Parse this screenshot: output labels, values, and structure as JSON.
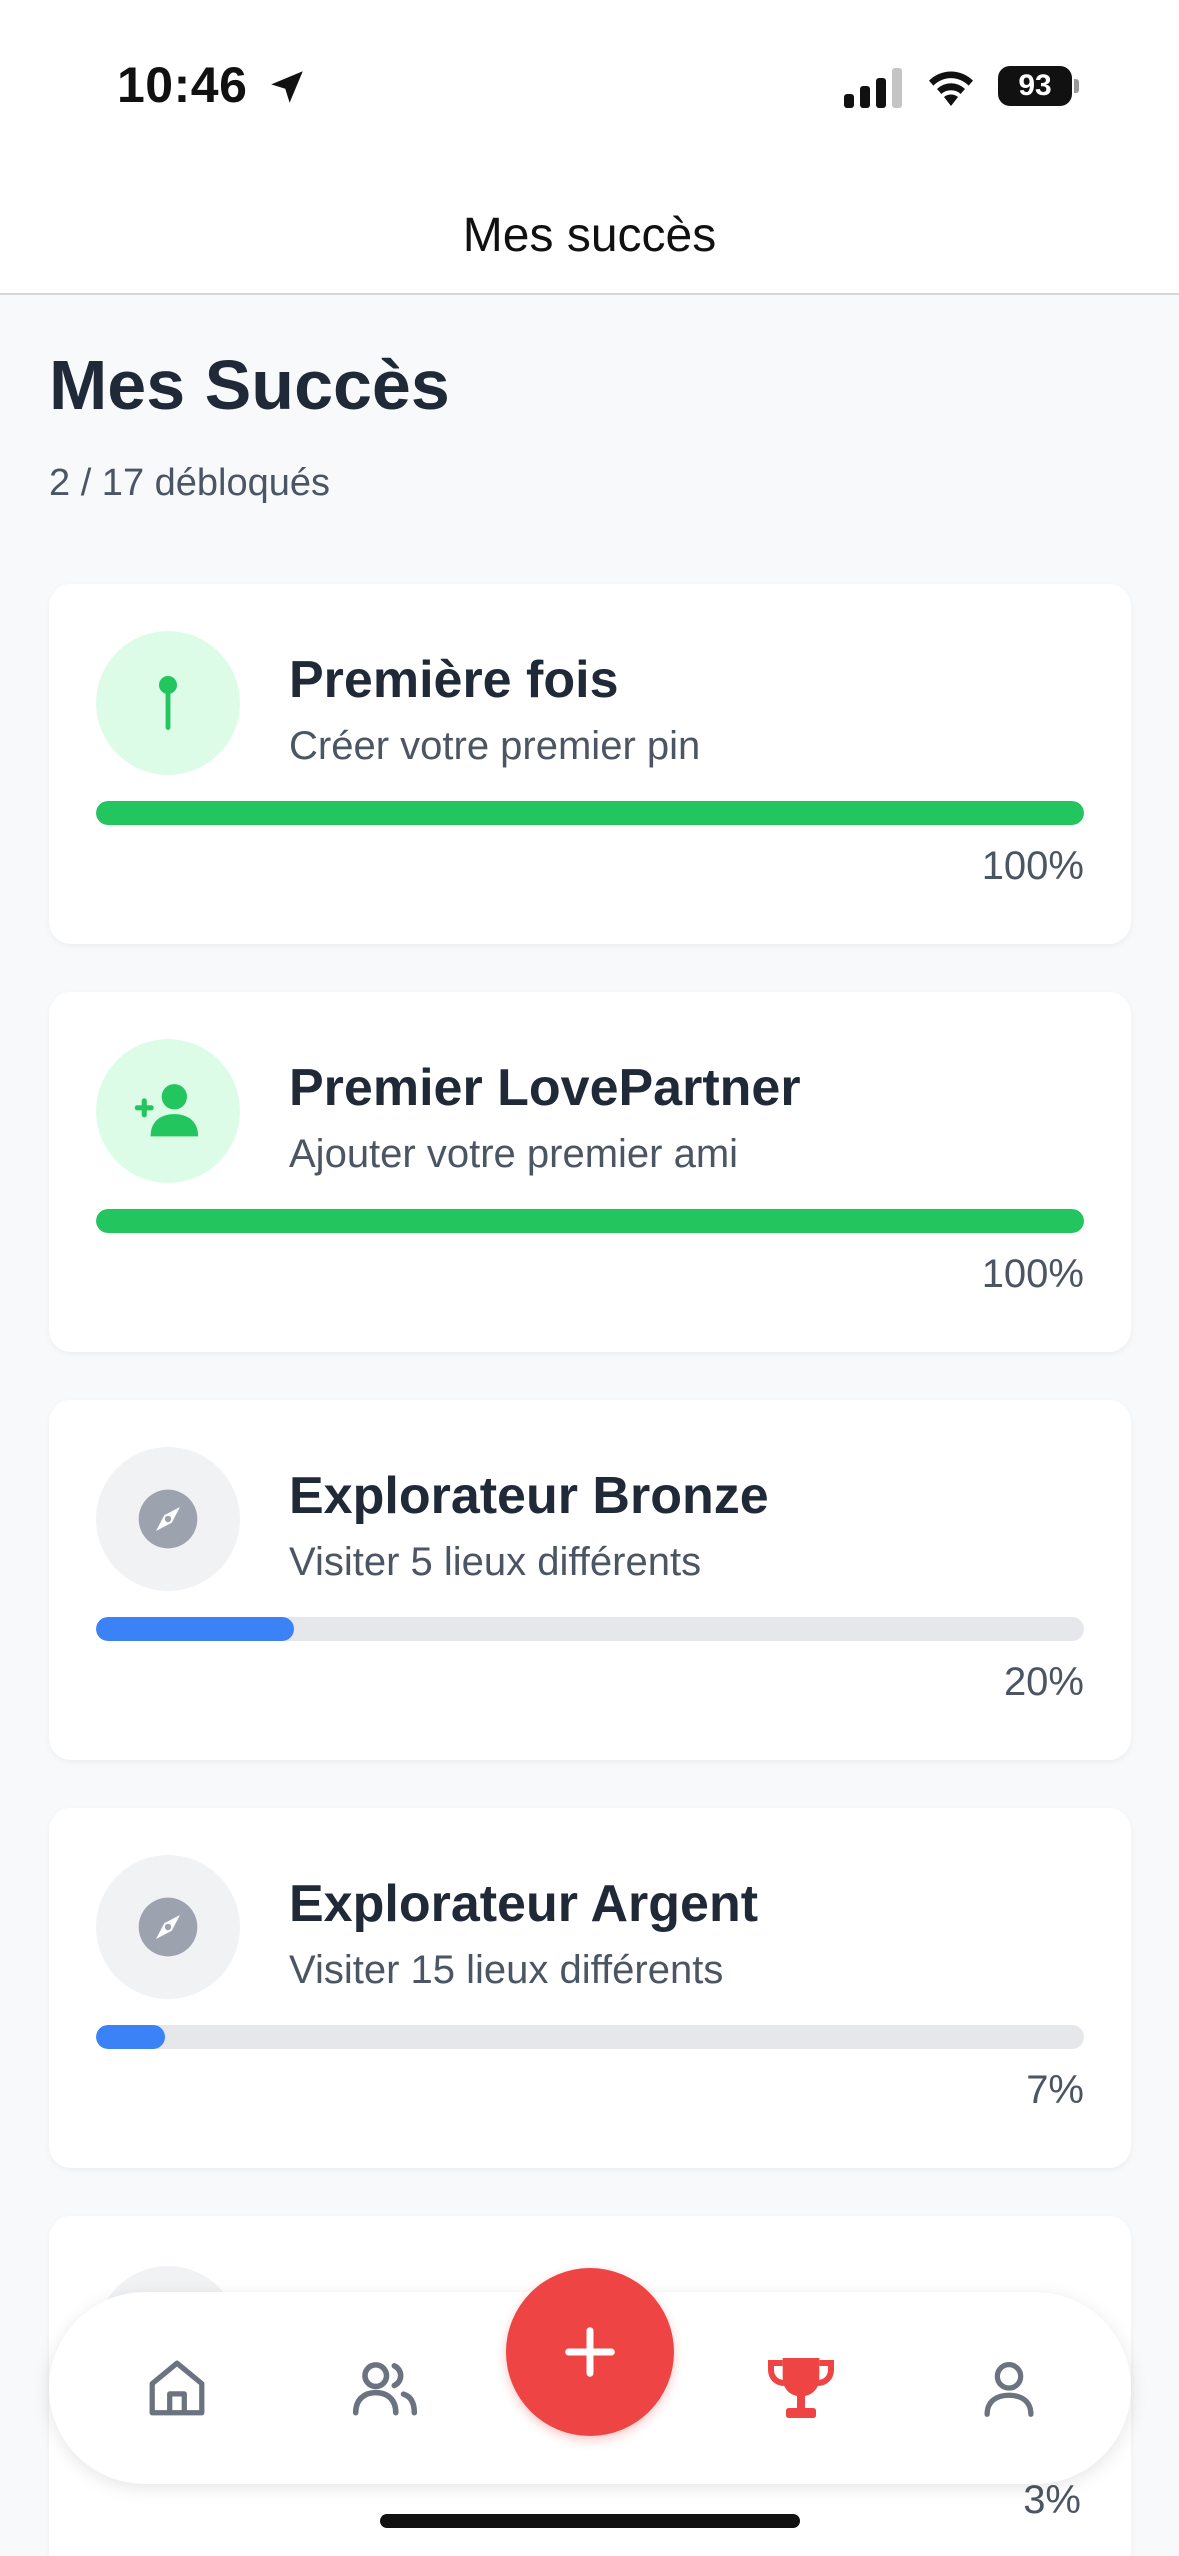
{
  "status_bar": {
    "time": "10:46",
    "battery": "93",
    "icons": [
      "location-arrow-icon",
      "cellular-signal-icon",
      "wifi-icon",
      "battery-icon"
    ]
  },
  "header": {
    "title": "Mes succès"
  },
  "page": {
    "title": "Mes Succès",
    "subtitle": "2 / 17 débloqués"
  },
  "colors": {
    "unlocked": "#22c55e",
    "in_progress": "#3b82f6",
    "accent": "#ef4444",
    "icon_gray": "#9ca3af"
  },
  "achievements": [
    {
      "title": "Première fois",
      "description": "Créer votre premier pin",
      "percent_label": "100%",
      "progress": 1.0,
      "icon": "pin-icon",
      "unlocked": true
    },
    {
      "title": "Premier LovePartner",
      "description": "Ajouter votre premier ami",
      "percent_label": "100%",
      "progress": 1.0,
      "icon": "user-plus-icon",
      "unlocked": true
    },
    {
      "title": "Explorateur Bronze",
      "description": "Visiter 5 lieux différents",
      "percent_label": "20%",
      "progress": 0.2,
      "icon": "compass-icon",
      "unlocked": false
    },
    {
      "title": "Explorateur Argent",
      "description": "Visiter 15 lieux différents",
      "percent_label": "7%",
      "progress": 0.07,
      "icon": "compass-icon",
      "unlocked": false
    },
    {
      "percent_label": "3%"
    }
  ],
  "tab_bar": {
    "items": [
      {
        "icon": "home-icon",
        "active": false
      },
      {
        "icon": "friends-icon",
        "active": false
      },
      {
        "icon": "add-icon",
        "active": false
      },
      {
        "icon": "trophy-icon",
        "active": true
      },
      {
        "icon": "profile-icon",
        "active": false
      }
    ]
  }
}
